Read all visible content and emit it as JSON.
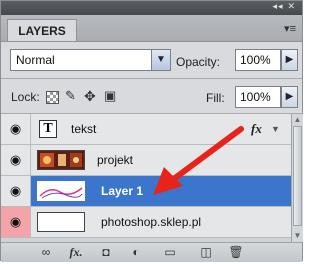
{
  "panel": {
    "tab_label": "LAYERS",
    "collapse_glyph": "◂◂",
    "close_glyph": "✕",
    "menu_glyph": "▾≡"
  },
  "controls": {
    "blend_mode": "Normal",
    "opacity_label": "Opacity:",
    "opacity_value": "100%",
    "lock_label": "Lock:",
    "fill_label": "Fill:",
    "fill_value": "100%"
  },
  "layers": [
    {
      "name": "tekst",
      "type": "text",
      "thumb_glyph": "T",
      "fx": "fx",
      "visible": true,
      "selected": false
    },
    {
      "name": "projekt",
      "type": "image",
      "visible": true,
      "selected": false
    },
    {
      "name": "Layer 1",
      "type": "image",
      "visible": true,
      "selected": true
    },
    {
      "name": "photoshop.sklep.pl",
      "type": "image",
      "visible": true,
      "selected": false,
      "eye_highlight": "#f4a3a9"
    }
  ],
  "bottom_toolbar": {
    "fx_label": "fx."
  },
  "icons": {
    "eye": "eye-icon",
    "lock_transparent": "checkerboard-lock-icon",
    "lock_brush": "brush-lock-icon",
    "lock_move": "move-lock-icon",
    "lock_all": "padlock-icon",
    "link": "link-layers-icon",
    "mask": "add-mask-icon",
    "adjust": "adjustment-layer-icon",
    "folder": "new-group-icon",
    "new_layer": "new-layer-icon",
    "trash": "delete-layer-icon"
  },
  "colors": {
    "selected_row": "#3c76cc",
    "annotation_arrow": "#e8231b"
  }
}
